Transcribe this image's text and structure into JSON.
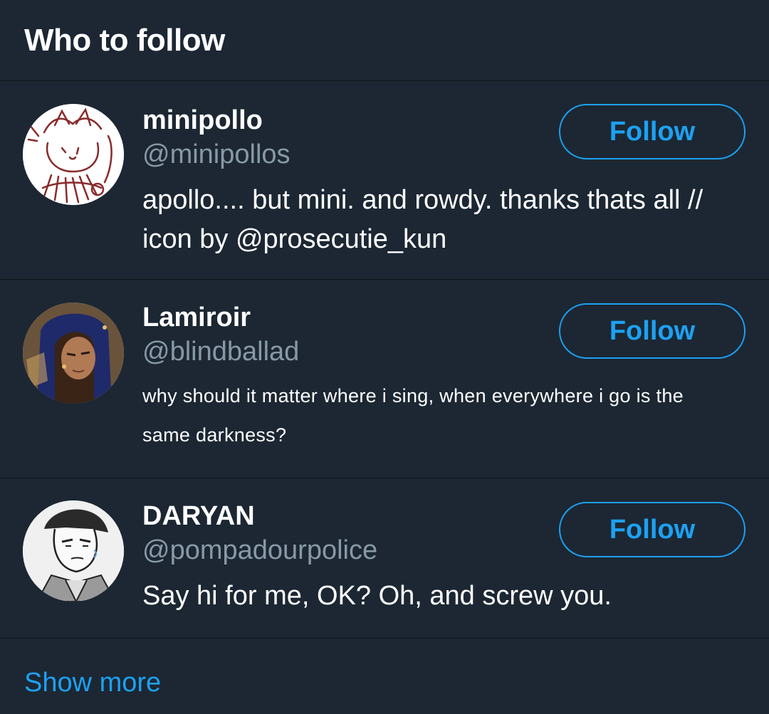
{
  "header": {
    "title": "Who to follow"
  },
  "users": [
    {
      "name": "minipollo",
      "handle": "@minipollos",
      "bio": "apollo.... but mini. and rowdy. thanks thats all // icon by @prosecutie_kun",
      "follow_label": "Follow"
    },
    {
      "name": "Lamiroir",
      "handle": "@blindballad",
      "bio": "why should it matter where i sing, when everywhere i go is the same darkness?",
      "follow_label": "Follow"
    },
    {
      "name": "DARYAN",
      "handle": "@pompadourpolice",
      "bio": "Say hi for me, OK? Oh, and screw you.",
      "follow_label": "Follow"
    }
  ],
  "footer": {
    "show_more_label": "Show more"
  },
  "colors": {
    "background": "#1c2733",
    "accent": "#1da1f2",
    "secondary_text": "#8899a6",
    "divider": "#0e1419"
  }
}
